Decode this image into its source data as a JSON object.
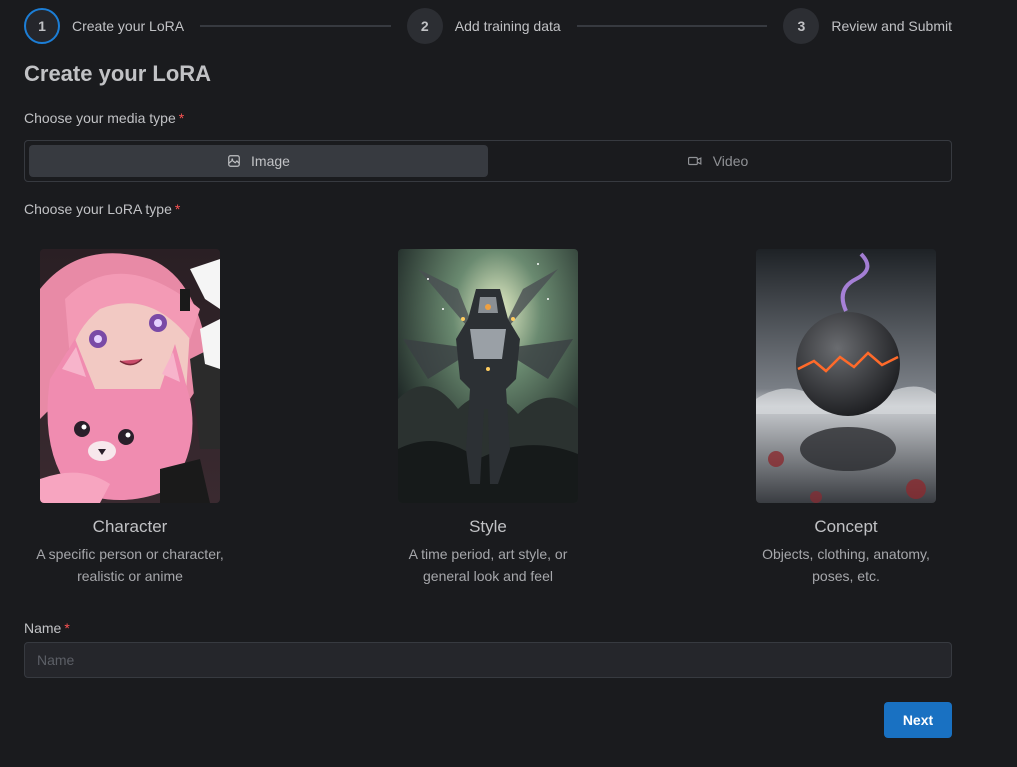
{
  "stepper": {
    "steps": [
      {
        "number": "1",
        "label": "Create your LoRA"
      },
      {
        "number": "2",
        "label": "Add training data"
      },
      {
        "number": "3",
        "label": "Review and Submit"
      }
    ]
  },
  "page_title": "Create your LoRA",
  "media_type": {
    "label": "Choose your media type",
    "required_mark": "*",
    "options": [
      {
        "label": "Image",
        "icon": "photo-icon",
        "selected": true
      },
      {
        "label": "Video",
        "icon": "video-icon",
        "selected": false
      }
    ]
  },
  "lora_type": {
    "label": "Choose your LoRA type",
    "required_mark": "*",
    "options": [
      {
        "title": "Character",
        "description": "A specific person or character, realistic or anime",
        "image": "anime girl with pink hair holding pink cat plush"
      },
      {
        "title": "Style",
        "description": "A time period, art style, or general look and feel",
        "image": "mecha robot in stormy sky"
      },
      {
        "title": "Concept",
        "description": "Objects, clothing, anatomy, poses, etc.",
        "image": "cracked planet with glowing fissure over reflective sea"
      }
    ]
  },
  "name_field": {
    "label": "Name",
    "required_mark": "*",
    "placeholder": "Name",
    "value": ""
  },
  "actions": {
    "next_label": "Next"
  },
  "colors": {
    "accent": "#1971c2",
    "required": "#fa5252",
    "background": "#1a1b1e"
  }
}
